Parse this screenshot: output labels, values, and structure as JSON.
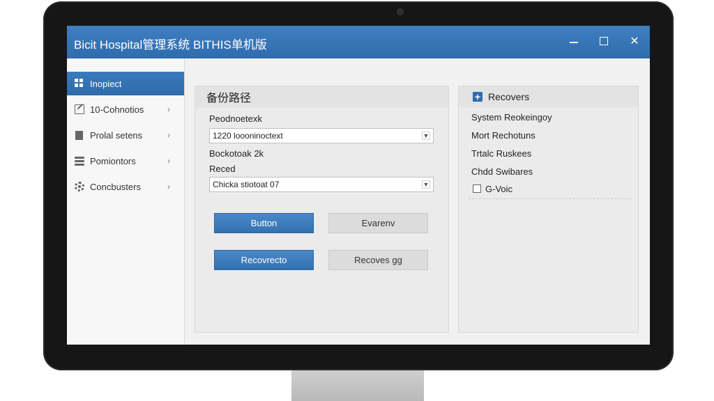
{
  "window": {
    "title": "Bicit Hospital管理系统 BITHIS单机版",
    "minimize_icon": "minimize-icon",
    "maximize_icon": "maximize-icon",
    "close_icon": "close-icon",
    "titlebar_color": "#3a78ba"
  },
  "sidebar": {
    "items": [
      {
        "label": "Inopiect",
        "icon": "grid-icon",
        "active": true
      },
      {
        "label": "10-Cohnotios",
        "icon": "edit-icon",
        "chevron": "›"
      },
      {
        "label": "Prolal setens",
        "icon": "document-icon",
        "chevron": "›"
      },
      {
        "label": "Pomiontors",
        "icon": "database-icon",
        "chevron": "›"
      },
      {
        "label": "Concbusters",
        "icon": "gear-icon",
        "chevron": "›"
      }
    ]
  },
  "backup_panel": {
    "title": "备份路径",
    "field1_label": "Peodnoetexk",
    "field1_value": "1220 loooninoctext",
    "field2_label": "Bockotoak 2k",
    "field3_label": "Reced",
    "field3_value": "Chicka stiotoat 07",
    "btn_button": "Button",
    "btn_evarenv": "Evarenv",
    "btn_recovrecto": "Recovrecto",
    "btn_recovesgg": "Recoves gg",
    "accent_color": "#3a78ba"
  },
  "recovers_panel": {
    "title": "Recovers",
    "items": [
      "System Reokeingoy",
      "Mort Rechotuns",
      "Trtalc Ruskees",
      "Chdd Swibares"
    ],
    "checkbox_label": "G-Voic"
  }
}
